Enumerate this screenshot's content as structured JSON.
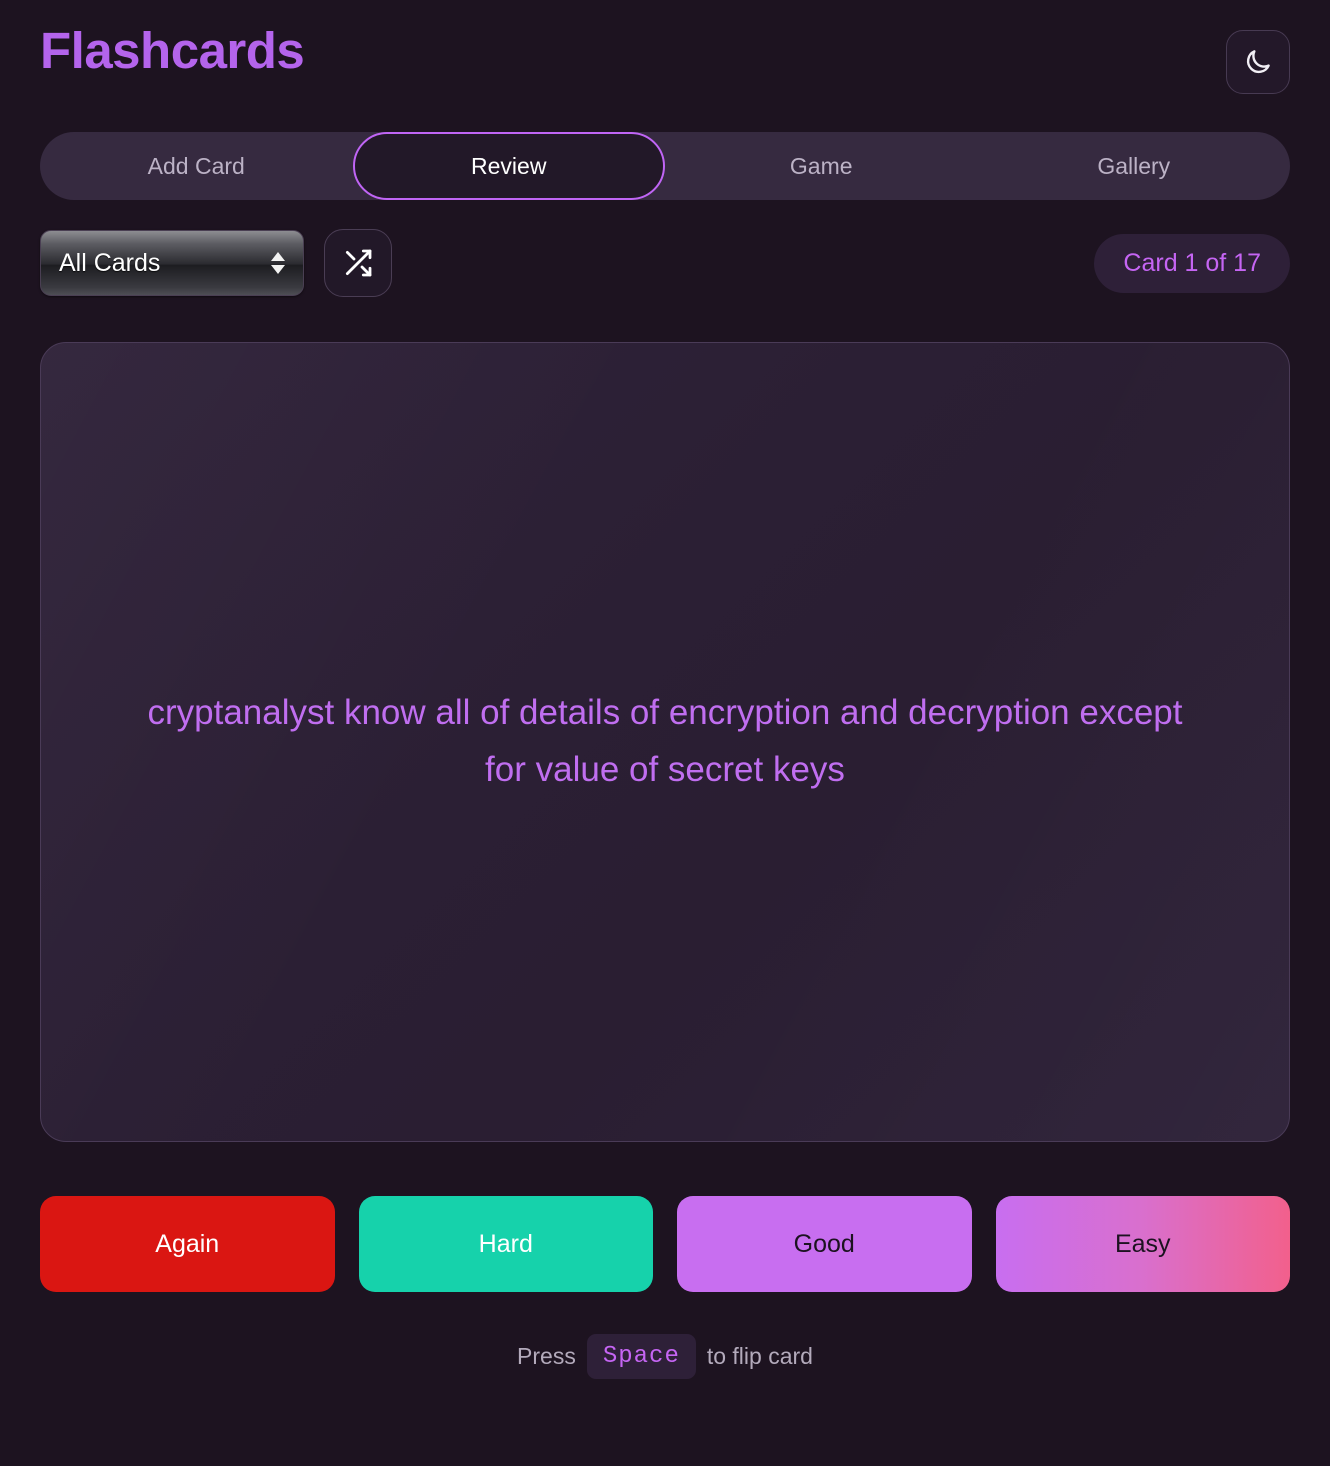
{
  "header": {
    "title": "Flashcards",
    "theme_toggle_icon": "moon-icon"
  },
  "tabs": [
    {
      "label": "Add Card",
      "active": false
    },
    {
      "label": "Review",
      "active": true
    },
    {
      "label": "Game",
      "active": false
    },
    {
      "label": "Gallery",
      "active": false
    }
  ],
  "controls": {
    "deck_select_value": "All Cards",
    "shuffle_icon": "shuffle-icon",
    "counter": "Card 1 of 17"
  },
  "flashcard": {
    "text": "cryptanalyst know all of details of encryption and decryption except for value of secret keys"
  },
  "ratings": [
    {
      "label": "Again",
      "color": "#da1612"
    },
    {
      "label": "Hard",
      "color": "#16d2ab"
    },
    {
      "label": "Good",
      "color": "#c86ef0"
    },
    {
      "label": "Easy",
      "color": "#f2608c"
    }
  ],
  "hint": {
    "prefix": "Press",
    "key": "Space",
    "suffix": "to flip card"
  },
  "theme": {
    "background": "#1d1320",
    "accent": "#c065f5",
    "title_color": "#b464ec",
    "tabbar_background": "#362a40",
    "card_background": "#2d2134",
    "badge_background": "#2e2038"
  }
}
